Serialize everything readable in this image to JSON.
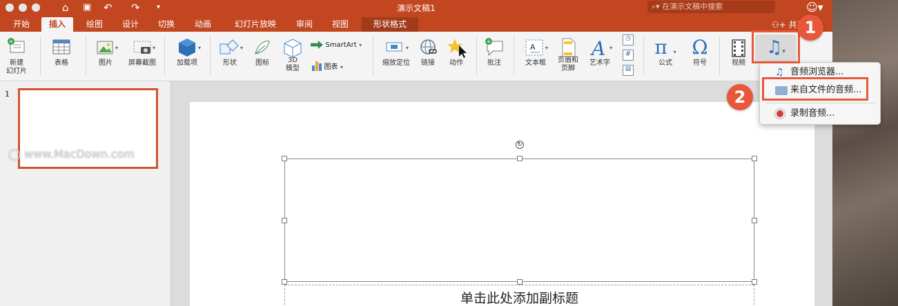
{
  "window": {
    "title": "演示文稿1",
    "search_placeholder": "在演示文稿中搜索"
  },
  "tabs": [
    {
      "label": "开始"
    },
    {
      "label": "插入"
    },
    {
      "label": "绘图"
    },
    {
      "label": "设计"
    },
    {
      "label": "切换"
    },
    {
      "label": "动画"
    },
    {
      "label": "幻灯片放映"
    },
    {
      "label": "审阅"
    },
    {
      "label": "视图"
    },
    {
      "label": "形状格式"
    }
  ],
  "share_label": "共享",
  "ribbon": {
    "new_slide": "新建\n幻灯片",
    "table": "表格",
    "picture": "图片",
    "screenshot": "屏幕截图",
    "addins": "加载项",
    "shapes": "形状",
    "icons": "图标",
    "model3d": "3D\n模型",
    "smartart": "SmartArt",
    "chart": "图表",
    "zoom": "缩放定位",
    "link": "链接",
    "action": "动作",
    "comment": "批注",
    "textbox": "文本框",
    "header_footer": "页眉和\n页脚",
    "wordart": "艺术字",
    "equation": "公式",
    "symbol": "符号",
    "video": "视频",
    "pi_glyph": "π",
    "omega_glyph": "Ω",
    "hash_glyph": "#"
  },
  "slide_panel": {
    "slide_number": "1",
    "watermark": "www.MacDown.com"
  },
  "slide": {
    "subtitle_placeholder": "单击此处添加副标题"
  },
  "audio_menu": {
    "items": [
      {
        "label": "音频浏览器..."
      },
      {
        "label": "来自文件的音频..."
      },
      {
        "label": "录制音频..."
      }
    ]
  },
  "callouts": {
    "step1": "1",
    "step2": "2"
  },
  "colors": {
    "accent": "#c2461f",
    "callout": "#e8573a"
  },
  "icons": [
    "home-icon",
    "save-icon",
    "undo-icon",
    "redo-icon",
    "search-icon",
    "smiley-icon",
    "audio-icon",
    "folder-icon",
    "record-icon"
  ]
}
